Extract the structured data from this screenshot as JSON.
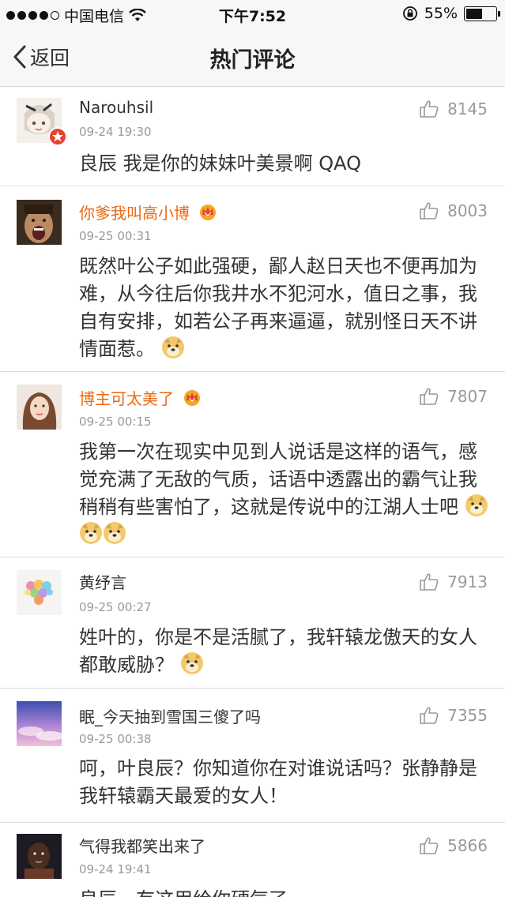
{
  "status": {
    "carrier": "中国电信",
    "time": "下午7:52",
    "battery_text": "55%",
    "battery_level": 0.55
  },
  "nav": {
    "back_label": "返回",
    "title": "热门评论"
  },
  "comments": [
    {
      "user": "Narouhsil",
      "time": "09-24 19:30",
      "text": "良辰 我是你的妹妹叶美景啊 QAQ",
      "likes": "8145",
      "vip": false
    },
    {
      "user": "你爹我叫高小博",
      "time": "09-25 00:31",
      "text": "既然叶公子如此强硬，鄙人赵日天也不便再加为难，从今往后你我井水不犯河水，值日之事，我自有安排，如若公子再来逼逼，就别怪日天不讲情面惹。",
      "likes": "8003",
      "vip": true
    },
    {
      "user": "博主可太美了",
      "time": "09-25 00:15",
      "text": "我第一次在现实中见到人说话是这样的语气，感觉充满了无敌的气质，话语中透露出的霸气让我稍稍有些害怕了，这就是传说中的江湖人士吧",
      "likes": "7807",
      "vip": true
    },
    {
      "user": "黄纾言",
      "time": "09-25 00:27",
      "text": "姓叶的，你是不是活腻了，我轩辕龙傲天的女人都敢威胁？",
      "likes": "7913",
      "vip": false
    },
    {
      "user": "眠_今天抽到雪国三傻了吗",
      "time": "09-25 00:38",
      "text": "呵，叶良辰？你知道你在对谁说话吗？张静静是我轩辕霸天最爱的女人！",
      "likes": "7355",
      "vip": false
    },
    {
      "user": "气得我都笑出来了",
      "time": "09-24 19:41",
      "text": "良辰，有这用给你硬气了",
      "likes": "5866",
      "vip": false
    }
  ],
  "icons": {
    "like": "thumbs-up-icon",
    "back": "chevron-left-icon",
    "emoji": "doge-emoji-icon",
    "crown": "vip-crown-icon"
  },
  "colors": {
    "vip_name": "#ea6a13",
    "meta": "#999999",
    "text": "#333333"
  }
}
